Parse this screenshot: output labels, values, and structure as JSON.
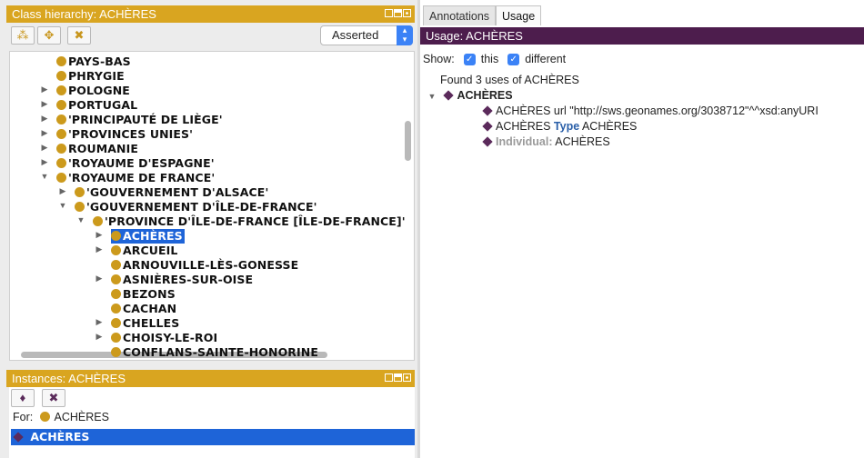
{
  "class_hierarchy": {
    "title": "Class hierarchy: ACHÈRES",
    "mode": "Asserted",
    "toolbar": [
      "add-subclass-icon",
      "add-sibling-icon",
      "delete-class-icon"
    ],
    "items": [
      {
        "label": "PAYS-BAS",
        "expand": "none"
      },
      {
        "label": "PHRYGIE",
        "expand": "none"
      },
      {
        "label": "POLOGNE",
        "expand": "collapsed"
      },
      {
        "label": "PORTUGAL",
        "expand": "collapsed"
      },
      {
        "label": "'PRINCIPAUTÉ DE LIÈGE'",
        "expand": "collapsed"
      },
      {
        "label": "'PROVINCES UNIES'",
        "expand": "collapsed"
      },
      {
        "label": "ROUMANIE",
        "expand": "collapsed"
      },
      {
        "label": "'ROYAUME D'ESPAGNE'",
        "expand": "collapsed"
      },
      {
        "label": "'ROYAUME DE FRANCE'",
        "expand": "expanded"
      },
      {
        "label": "'GOUVERNEMENT D'ALSACE'",
        "expand": "collapsed"
      },
      {
        "label": "'GOUVERNEMENT D'ÎLE-DE-FRANCE'",
        "expand": "expanded"
      },
      {
        "label": "'PROVINCE D'ÎLE-DE-FRANCE [ÎLE-DE-FRANCE]'",
        "expand": "expanded"
      },
      {
        "label": "ACHÈRES",
        "expand": "collapsed",
        "selected": true
      },
      {
        "label": "ARCUEIL",
        "expand": "collapsed"
      },
      {
        "label": "ARNOUVILLE-LÈS-GONESSE",
        "expand": "none"
      },
      {
        "label": "ASNIÈRES-SUR-OISE",
        "expand": "collapsed"
      },
      {
        "label": "BEZONS",
        "expand": "none"
      },
      {
        "label": "CACHAN",
        "expand": "none"
      },
      {
        "label": "CHELLES",
        "expand": "collapsed"
      },
      {
        "label": "CHOISY-LE-ROI",
        "expand": "collapsed"
      },
      {
        "label": "CONFLANS-SAINTE-HONORINE",
        "expand": "none"
      }
    ]
  },
  "instances": {
    "title": "Instances: ACHÈRES",
    "toolbar": [
      "add-individual-icon",
      "delete-individual-icon"
    ],
    "for_label": "For:",
    "for_value": "ACHÈRES",
    "selected_item": "ACHÈRES"
  },
  "usage": {
    "tabs": [
      "Annotations",
      "Usage"
    ],
    "active_tab": "Usage",
    "title": "Usage: ACHÈRES",
    "show_label": "Show:",
    "check_this": "this",
    "check_different": "different",
    "found_text": "Found 3 uses of ACHÈRES",
    "root": "ACHÈRES",
    "line1": "ACHÈRES url \"http://sws.geonames.org/3038712\"^^xsd:anyURI",
    "line2_subject": "ACHÈRES",
    "line2_keyword": "Type",
    "line2_object": "ACHÈRES",
    "line3_keyword": "Individual:",
    "line3_object": "ACHÈRES"
  },
  "colors": {
    "class_header": "#d9a520",
    "usage_header": "#4d1d4d",
    "selection": "#1e64d8",
    "class_dot": "#cc9a1c",
    "individual_diamond": "#5b2a5b"
  }
}
